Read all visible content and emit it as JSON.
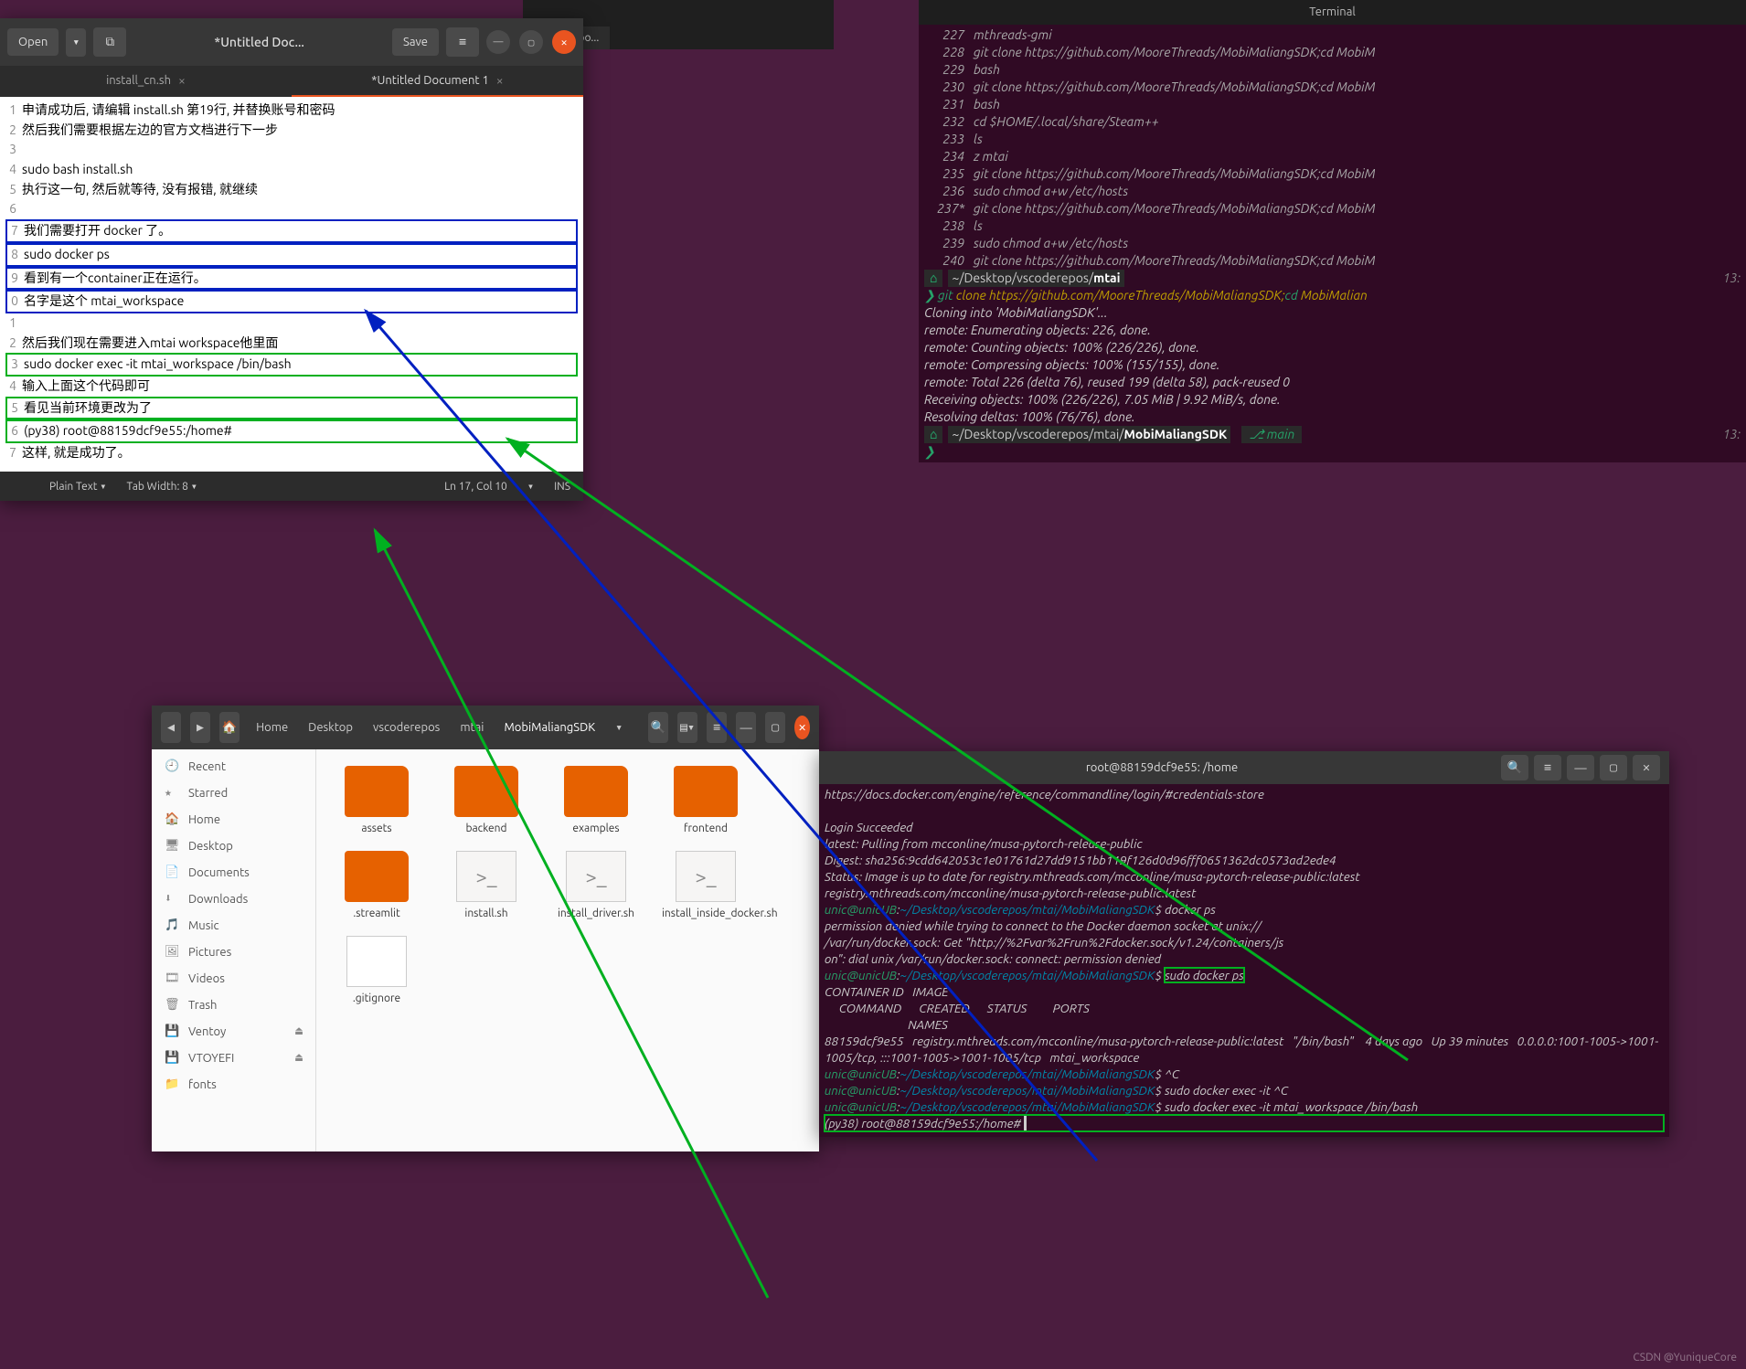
{
  "gedit": {
    "open": "Open",
    "save": "Save",
    "title": "*Untitled Doc...",
    "tabs": [
      {
        "label": "install_cn.sh"
      },
      {
        "label": "*Untitled Document 1"
      }
    ],
    "lines": [
      {
        "n": "1",
        "t": "申请成功后, 请编辑 install.sh 第19行, 并替换账号和密码"
      },
      {
        "n": "2",
        "t": "然后我们需要根据左边的官方文档进行下一步"
      },
      {
        "n": "3",
        "t": ""
      },
      {
        "n": "4",
        "t": "sudo bash install.sh"
      },
      {
        "n": "5",
        "t": "执行这一句, 然后就等待, 没有报错, 就继续"
      },
      {
        "n": "6",
        "t": ""
      },
      {
        "n": "7",
        "t": "我们需要打开 docker 了。"
      },
      {
        "n": "8",
        "t": "sudo docker ps"
      },
      {
        "n": "9",
        "t": "看到有一个container正在运行。"
      },
      {
        "n": "0",
        "t": "名字是这个 mtai_workspace"
      },
      {
        "n": "1",
        "t": ""
      },
      {
        "n": "2",
        "t": "然后我们现在需要进入mtai workspace他里面"
      },
      {
        "n": "3",
        "t": "sudo docker exec -it mtai_workspace /bin/bash"
      },
      {
        "n": "4",
        "t": "输入上面这个代码即可"
      },
      {
        "n": "5",
        "t": "看见当前环境更改为了"
      },
      {
        "n": "6",
        "t": "(py38) root@88159dcf9e55:/home#"
      },
      {
        "n": "7",
        "t": "这样, 就是成功了。"
      }
    ],
    "status": {
      "lang": "Plain Text ▾",
      "tabw": "Tab Width: 8 ▾",
      "lncol": "Ln 17, Col 10",
      "ins": "INS"
    }
  },
  "vsc": {
    "tab": "vscoderepo..."
  },
  "term1": {
    "title": "Terminal",
    "history": [
      {
        "n": "227",
        "c": "mthreads-gmi"
      },
      {
        "n": "228",
        "c": "git clone https://github.com/MooreThreads/MobiMaliangSDK;cd MobiM"
      },
      {
        "n": "229",
        "c": "bash"
      },
      {
        "n": "230",
        "c": "git clone https://github.com/MooreThreads/MobiMaliangSDK;cd MobiM"
      },
      {
        "n": "231",
        "c": "bash"
      },
      {
        "n": "232",
        "c": "cd $HOME/.local/share/Steam++"
      },
      {
        "n": "233",
        "c": "ls"
      },
      {
        "n": "234",
        "c": "z mtai"
      },
      {
        "n": "235",
        "c": "git clone https://github.com/MooreThreads/MobiMaliangSDK;cd MobiM"
      },
      {
        "n": "236",
        "c": "sudo chmod a+w /etc/hosts"
      },
      {
        "n": "237*",
        "c": "git clone https://github.com/MooreThreads/MobiMaliangSDK;cd MobiM"
      },
      {
        "n": "238",
        "c": "ls"
      },
      {
        "n": "239",
        "c": "sudo chmod a+w /etc/hosts"
      },
      {
        "n": "240",
        "c": "git clone https://github.com/MooreThreads/MobiMaliangSDK;cd MobiM"
      }
    ],
    "p1_path_a": "~/Desktop/vscoderepos/",
    "p1_path_b": "mtai",
    "p1_time": "13:",
    "git_cmd_a": "git",
    "git_cmd_b": " clone https://github.com/MooreThreads/MobiMaliangSDK;",
    "git_cmd_c": "cd",
    "git_cmd_d": " MobiMalian",
    "clone_out": [
      "Cloning into 'MobiMaliangSDK'...",
      "remote: Enumerating objects: 226, done.",
      "remote: Counting objects: 100% (226/226), done.",
      "remote: Compressing objects: 100% (155/155), done.",
      "remote: Total 226 (delta 76), reused 199 (delta 58), pack-reused 0",
      "Receiving objects: 100% (226/226), 7.05 MiB | 9.92 MiB/s, done.",
      "Resolving deltas: 100% (76/76), done."
    ],
    "p2_path_a": "~/Desktop/vscoderepos/mtai/",
    "p2_path_b": "MobiMaliangSDK",
    "branch": "⎇  main",
    "p2_time": "13:",
    "arrow": "❯"
  },
  "naut": {
    "crumbs": [
      "Home",
      "Desktop",
      "vscoderepos",
      "mtai",
      "MobiMaliangSDK"
    ],
    "side": [
      {
        "icon": "🕘",
        "label": "Recent"
      },
      {
        "icon": "★",
        "label": "Starred"
      },
      {
        "icon": "🏠",
        "label": "Home"
      },
      {
        "icon": "🖥",
        "label": "Desktop"
      },
      {
        "icon": "📄",
        "label": "Documents"
      },
      {
        "icon": "⬇",
        "label": "Downloads"
      },
      {
        "icon": "🎵",
        "label": "Music"
      },
      {
        "icon": "🖼",
        "label": "Pictures"
      },
      {
        "icon": "🎞",
        "label": "Videos"
      },
      {
        "icon": "🗑",
        "label": "Trash"
      },
      {
        "icon": "💾",
        "label": "Ventoy",
        "eject": true
      },
      {
        "icon": "💾",
        "label": "VTOYEFI",
        "eject": true
      },
      {
        "icon": "📁",
        "label": "fonts"
      }
    ],
    "files": [
      {
        "type": "folder",
        "name": "assets"
      },
      {
        "type": "folder",
        "name": "backend"
      },
      {
        "type": "folder",
        "name": "examples"
      },
      {
        "type": "folder",
        "name": "frontend"
      },
      {
        "type": "folder",
        "name": ".streamlit"
      },
      {
        "type": "sh",
        "name": "install.sh"
      },
      {
        "type": "sh",
        "name": "install_driver.sh"
      },
      {
        "type": "sh",
        "name": "install_inside_docker.sh"
      },
      {
        "type": "txt",
        "name": ".gitignore"
      }
    ]
  },
  "term2": {
    "title": "root@88159dcf9e55: /home",
    "lines": [
      "https://docs.docker.com/engine/reference/commandline/login/#credentials-store",
      "",
      "Login Succeeded",
      "latest: Pulling from mcconline/musa-pytorch-release-public",
      "Digest: sha256:9cdd642053c1e01761d27dd9151bb119f126d0d96fff0651362dc0573ad2ede4",
      "Status: Image is up to date for registry.mthreads.com/mcconline/musa-pytorch-release-public:latest",
      "registry.mthreads.com/mcconline/musa-pytorch-release-public:latest"
    ],
    "user": "unic@unicUB",
    "path": "~/Desktop/vscoderepos/mtai/MobiMaliangSDK",
    "cmd1": "docker ps",
    "err": [
      "permission denied while trying to connect to the Docker daemon socket at unix://",
      "/var/run/docker.sock: Get \"http://%2Fvar%2Frun%2Fdocker.sock/v1.24/containers/js",
      "on\": dial unix /var/run/docker.sock: connect: permission denied"
    ],
    "cmd2": "sudo docker ps",
    "ps_out": [
      "CONTAINER ID   IMAGE                                   COMMAND       CREATED      STATUS         PORTS                         NAMES",
      "88159dcf9e55   registry.mthreads.com/mcconline/musa-pytorch-release-public:latest   \"/bin/bash\"    4 days ago   Up 39 minutes   0.0.0.0:1001-1005->1001-1005/tcp, :::1001-1005->1001-1005/tcp   mtai_workspace"
    ],
    "cmd3": "^C",
    "cmd4": "sudo docker exec -it ^C",
    "cmd5": "sudo docker exec -it mtai_workspace /bin/bash",
    "prompt_root": "(py38) root@88159dcf9e55:/home#"
  },
  "wmk": "CSDN @YuniqueCore"
}
